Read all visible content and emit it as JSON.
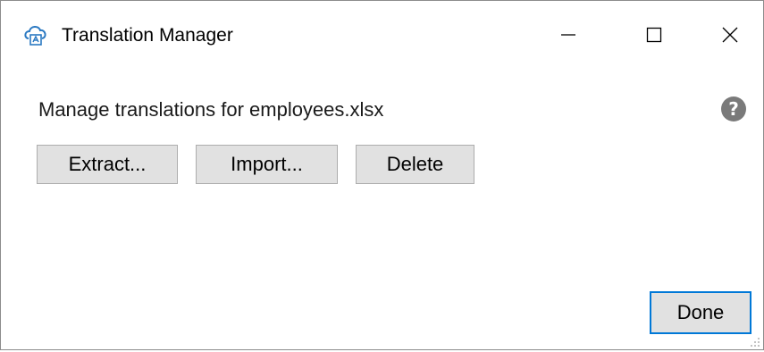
{
  "window": {
    "title": "Translation Manager",
    "icon": "cloud-translate-icon"
  },
  "caption_buttons": {
    "minimize": "—",
    "maximize": "☐",
    "close": "✕"
  },
  "main": {
    "instructions": "Manage translations for employees.xlsx",
    "help_icon": "?"
  },
  "buttons": {
    "extract": "Extract...",
    "import": "Import...",
    "delete": "Delete",
    "done": "Done"
  },
  "colors": {
    "button_face": "#e1e1e1",
    "button_border": "#adadad",
    "default_button_border": "#0078d7",
    "help_icon_bg": "#7a7a7a"
  }
}
